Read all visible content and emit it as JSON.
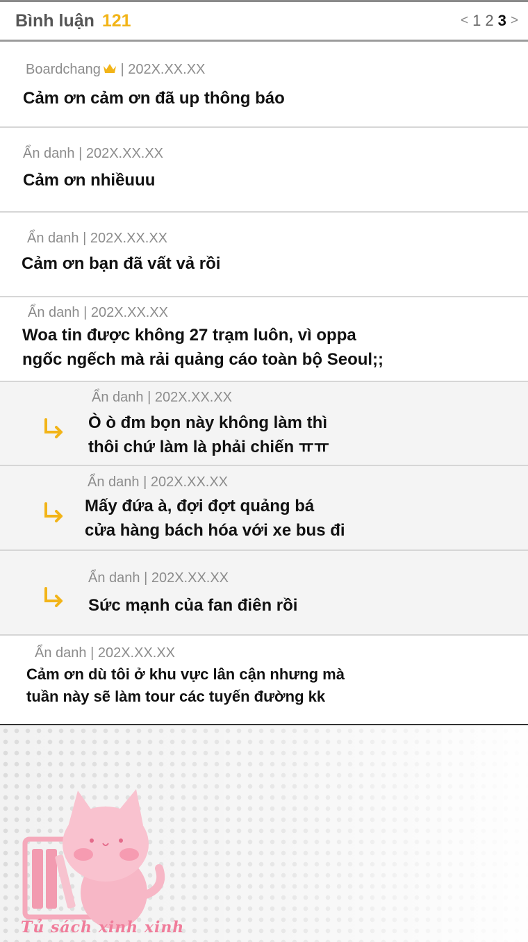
{
  "header": {
    "title": "Bình luận",
    "count": "121",
    "pager": {
      "prev": "<",
      "pages": [
        "1",
        "2",
        "3"
      ],
      "current": "3",
      "next": ">"
    }
  },
  "comments": [
    {
      "author": "Boardchang",
      "date": "202X.XX.XX",
      "has_crown": true,
      "lines": [
        "Cảm ơn cảm ơn đã up thông báo"
      ]
    },
    {
      "author": "Ẩn danh",
      "date": "202X.XX.XX",
      "lines": [
        "Cảm ơn nhiềuuu"
      ]
    },
    {
      "author": "Ẩn danh",
      "date": "202X.XX.XX",
      "lines": [
        "Cảm ơn bạn đã vất vả rồi"
      ]
    },
    {
      "author": "Ẩn danh",
      "date": "202X.XX.XX",
      "lines": [
        "Woa tin được không 27 trạm luôn, vì oppa",
        "ngốc ngếch mà rải quảng cáo toàn bộ Seoul;;"
      ]
    },
    {
      "author": "Ẩn danh",
      "date": "202X.XX.XX",
      "reply": true,
      "lines": [
        "Ò ò đm bọn này không làm thì",
        "thôi chứ làm là phải chiến ㅠㅠ"
      ]
    },
    {
      "author": "Ẩn danh",
      "date": "202X.XX.XX",
      "reply": true,
      "lines": [
        "Mấy đứa à, đợi đợt quảng bá",
        "cửa hàng bách hóa với xe bus đi"
      ]
    },
    {
      "author": "Ẩn danh",
      "date": "202X.XX.XX",
      "reply": true,
      "lines": [
        "Sức mạnh của fan điên rồi"
      ]
    },
    {
      "author": "Ẩn danh",
      "date": "202X.XX.XX",
      "lines": [
        "Cảm ơn dù tôi ở khu vực lân cận nhưng mà",
        "tuần này sẽ làm tour các tuyến đường kk"
      ]
    }
  ],
  "meta_separator": "|",
  "watermark": {
    "text": "Tủ sách xinh xinh",
    "icon": "pink-cat-bookshelf-logo"
  },
  "colors": {
    "accent": "#f2b418",
    "watermark_pink": "#f07c9a"
  }
}
